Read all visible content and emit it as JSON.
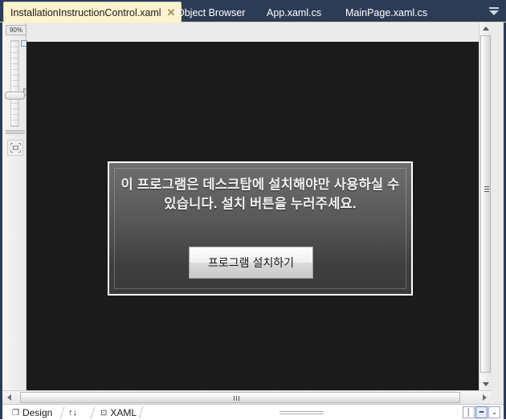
{
  "window": {
    "zoom_level": "90%",
    "accent_tabbar": "#2d3c56",
    "accent_active_tab": "#fdf3cf"
  },
  "tabs": [
    {
      "label": "InstallationInstructionControl.xaml",
      "active": true,
      "close": "✕"
    },
    {
      "label": "Object Browser",
      "active": false
    },
    {
      "label": "App.xaml.cs",
      "active": false
    },
    {
      "label": "MainPage.xaml.cs",
      "active": false
    }
  ],
  "tab_overflow": {
    "name": "tab-overflow-menu"
  },
  "designer": {
    "canvas_background": "#1b1b1b",
    "panel": {
      "message": "이 프로그램은 데스크탑에 설치해야만 사용하실 수있습니다. 설치 버튼을 누러주세요.",
      "button_label": "프로그램 설치하기",
      "text_color": "#f2f2f2",
      "border_color": "#ffffff"
    }
  },
  "bottom": {
    "design_tab": "Design",
    "swap_icon": "↑↓",
    "xaml_tab": "XAML",
    "xaml_icon": "⊡",
    "design_icon": "❐",
    "split_buttons": [
      {
        "name": "split-vertical-button",
        "glyph": "│",
        "selected": false
      },
      {
        "name": "split-horizontal-button",
        "glyph": "━",
        "selected": true
      },
      {
        "name": "collapse-pane-button",
        "glyph": "⌄",
        "selected": false
      }
    ]
  },
  "scrollbars": {
    "vertical": {
      "up": "▲",
      "down": "▼"
    },
    "horizontal": {
      "left": "◀",
      "right": "▶"
    }
  }
}
